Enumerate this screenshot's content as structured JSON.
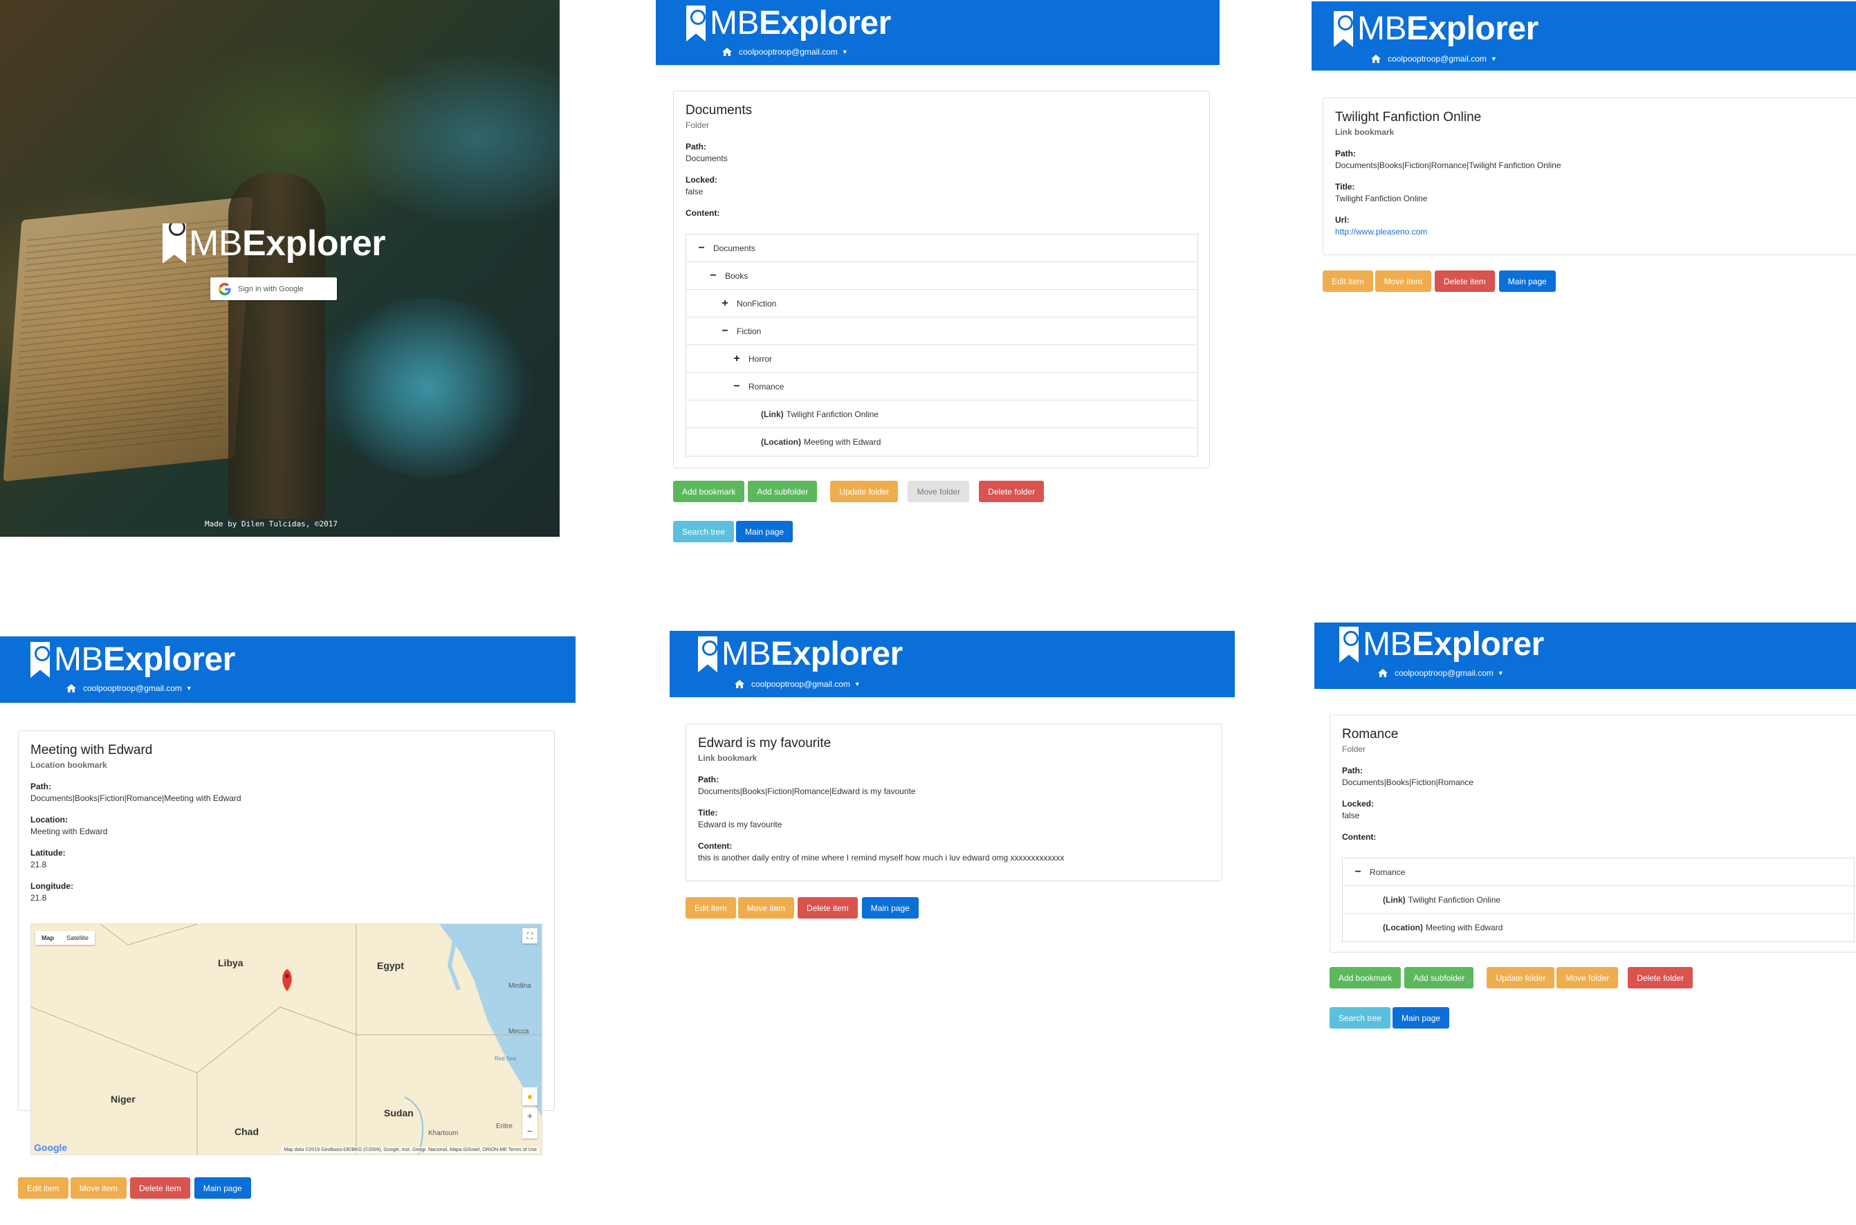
{
  "app": {
    "brand_light": "MB",
    "brand_bold": "Explorer",
    "user_email": "coolpooptroop@gmail.com"
  },
  "login": {
    "google_button": "Sign in with Google",
    "credit": "Made by Dilen Tulcidas, ©2017"
  },
  "buttons": {
    "add_bookmark": "Add bookmark",
    "add_subfolder": "Add subfolder",
    "update_folder": "Update folder",
    "move_folder": "Move folder",
    "delete_folder": "Delete folder",
    "search_tree": "Search tree",
    "main_page": "Main page",
    "edit_item": "Edit item",
    "move_item": "Move item",
    "delete_item": "Delete item"
  },
  "labels": {
    "path": "Path:",
    "locked": "Locked:",
    "content": "Content:",
    "title": "Title:",
    "url": "Url:",
    "location": "Location:",
    "latitude": "Latitude:",
    "longitude": "Longitude:"
  },
  "documents": {
    "title": "Documents",
    "type": "Folder",
    "path": "Documents",
    "locked": "false",
    "tree": [
      {
        "toggle": "−",
        "tag": "",
        "label": "Documents"
      },
      {
        "toggle": "−",
        "tag": "",
        "label": "Books"
      },
      {
        "toggle": "+",
        "tag": "",
        "label": "NonFiction"
      },
      {
        "toggle": "−",
        "tag": "",
        "label": "Fiction"
      },
      {
        "toggle": "+",
        "tag": "",
        "label": "Horror"
      },
      {
        "toggle": "−",
        "tag": "",
        "label": "Romance"
      },
      {
        "toggle": "",
        "tag": "(Link)",
        "label": "Twilight Fanfiction Online"
      },
      {
        "toggle": "",
        "tag": "(Location)",
        "label": "Meeting with Edward"
      }
    ]
  },
  "twilight": {
    "title": "Twilight Fanfiction Online",
    "type": "Link bookmark",
    "path": "Documents|Books|Fiction|Romance|Twilight Fanfiction Online",
    "title_value": "Twilight Fanfiction Online",
    "url": "http://www.pleaseno.com"
  },
  "meeting": {
    "title": "Meeting with Edward",
    "type": "Location bookmark",
    "path": "Documents|Books|Fiction|Romance|Meeting with Edward",
    "location": "Meeting with Edward",
    "latitude": "21.8",
    "longitude": "21.8",
    "map": {
      "type_map": "Map",
      "type_satellite": "Satellite",
      "places": [
        "Libya",
        "Egypt",
        "Niger",
        "Chad",
        "Sudan",
        "Medina",
        "Mecca",
        "Red Sea",
        "Khartoum",
        "Eritre"
      ],
      "logo": "Google",
      "attribution": "Map data ©2019 GeoBasis-DE/BKG (©2009), Google, Inst. Geogr. Nacional, Mapa GISrael, ORION-ME   Terms of Use"
    }
  },
  "edward": {
    "title": "Edward is my favourite",
    "type": "Link bookmark",
    "path": "Documents|Books|Fiction|Romance|Edward is my favourite",
    "title_value": "Edward is my favourite",
    "content": "this is another daily entry of mine where I remind myself how much i luv edward omg xxxxxxxxxxxxx"
  },
  "romance": {
    "title": "Romance",
    "type": "Folder",
    "path": "Documents|Books|Fiction|Romance",
    "locked": "false",
    "tree": [
      {
        "toggle": "−",
        "tag": "",
        "label": "Romance"
      },
      {
        "toggle": "",
        "tag": "(Link)",
        "label": "Twilight Fanfiction Online"
      },
      {
        "toggle": "",
        "tag": "(Location)",
        "label": "Meeting with Edward"
      }
    ]
  },
  "colors": {
    "header": "#0a6fd8",
    "green": "#5cb85c",
    "orange": "#f0ad4e",
    "red": "#d9534f",
    "cyan": "#5bc0de",
    "grey": "#e2e2e2"
  }
}
